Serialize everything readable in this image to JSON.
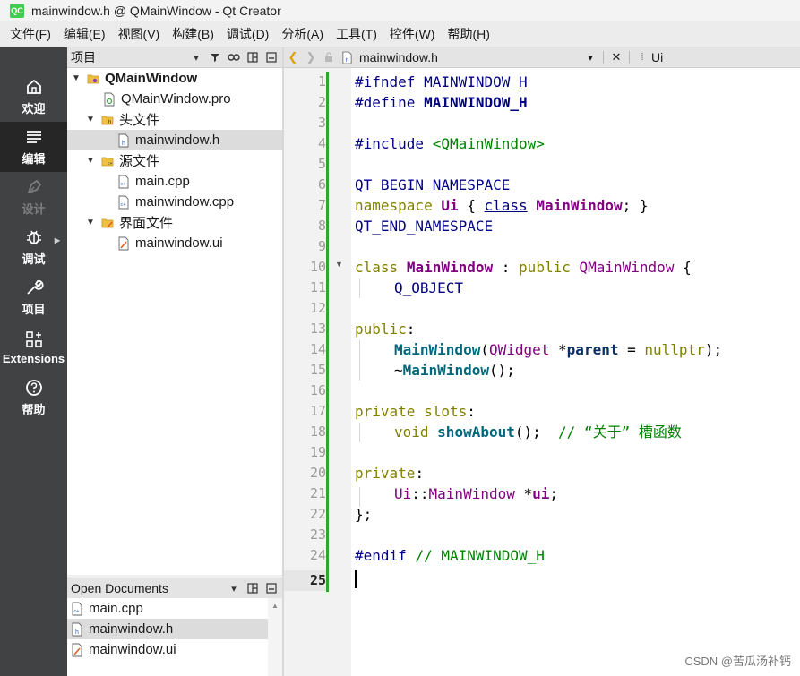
{
  "window": {
    "title": "mainwindow.h @ QMainWindow - Qt Creator",
    "logo": "QC"
  },
  "menu": [
    "文件(F)",
    "编辑(E)",
    "视图(V)",
    "构建(B)",
    "调试(D)",
    "分析(A)",
    "工具(T)",
    "控件(W)",
    "帮助(H)"
  ],
  "modes": [
    {
      "label": "欢迎",
      "icon": "home-icon"
    },
    {
      "label": "编辑",
      "icon": "edit-icon"
    },
    {
      "label": "设计",
      "icon": "design-icon"
    },
    {
      "label": "调试",
      "icon": "debug-icon"
    },
    {
      "label": "项目",
      "icon": "wrench-icon"
    },
    {
      "label": "Extensions",
      "icon": "extensions-icon"
    },
    {
      "label": "帮助",
      "icon": "help-icon"
    }
  ],
  "projects": {
    "header": "项目",
    "tree": [
      {
        "label": "QMainWindow",
        "depth": 0,
        "expanded": true,
        "kind": "project"
      },
      {
        "label": "QMainWindow.pro",
        "depth": 1,
        "kind": "pro"
      },
      {
        "label": "头文件",
        "depth": 1,
        "expanded": true,
        "kind": "folder"
      },
      {
        "label": "mainwindow.h",
        "depth": 2,
        "kind": "h"
      },
      {
        "label": "源文件",
        "depth": 1,
        "expanded": true,
        "kind": "folder"
      },
      {
        "label": "main.cpp",
        "depth": 2,
        "kind": "cpp"
      },
      {
        "label": "mainwindow.cpp",
        "depth": 2,
        "kind": "cpp"
      },
      {
        "label": "界面文件",
        "depth": 1,
        "expanded": true,
        "kind": "folder"
      },
      {
        "label": "mainwindow.ui",
        "depth": 2,
        "kind": "ui"
      }
    ]
  },
  "open_documents": {
    "header": "Open Documents",
    "items": [
      "main.cpp",
      "mainwindow.h",
      "mainwindow.ui"
    ]
  },
  "editor": {
    "file_name": "mainwindow.h",
    "symbol": "Ui",
    "line_numbers": [
      "1",
      "2",
      "3",
      "4",
      "5",
      "6",
      "7",
      "8",
      "9",
      "10",
      "11",
      "12",
      "13",
      "14",
      "15",
      "16",
      "17",
      "18",
      "19",
      "20",
      "21",
      "22",
      "23",
      "24",
      "25"
    ],
    "current_line": "25"
  },
  "code": {
    "l1": [
      "#ifndef",
      " ",
      "MAINWINDOW_H"
    ],
    "l2": [
      "#define",
      " ",
      "MAINWINDOW_H"
    ],
    "l4": [
      "#include",
      " ",
      "<QMainWindow>"
    ],
    "l6": [
      "QT_BEGIN_NAMESPACE"
    ],
    "l7": [
      "namespace",
      " ",
      "Ui",
      " { ",
      "class",
      " ",
      "MainWindow",
      "; }"
    ],
    "l8": [
      "QT_END_NAMESPACE"
    ],
    "l10": [
      "class",
      " ",
      "MainWindow",
      " : ",
      "public",
      " ",
      "QMainWindow",
      " {"
    ],
    "l11": [
      "Q_OBJECT"
    ],
    "l13": [
      "public",
      ":"
    ],
    "l14": [
      "MainWindow",
      "(",
      "QWidget",
      " *",
      "parent",
      " = ",
      "nullptr",
      ");"
    ],
    "l15": [
      "~",
      "MainWindow",
      "();"
    ],
    "l17": [
      "private",
      " ",
      "slots",
      ":"
    ],
    "l18": [
      "void",
      " ",
      "showAbout",
      "();  ",
      "// “关于” 槽函数"
    ],
    "l20": [
      "private",
      ":"
    ],
    "l21": [
      "Ui",
      "::",
      "MainWindow",
      " *",
      "ui",
      ";"
    ],
    "l22": [
      "};"
    ],
    "l24": [
      "#endif",
      " ",
      "// MAINWINDOW_H"
    ]
  },
  "watermark": "CSDN @苦瓜汤补钙"
}
